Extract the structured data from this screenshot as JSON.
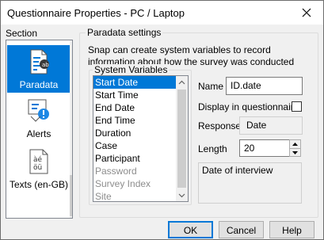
{
  "window": {
    "title": "Questionnaire Properties - PC / Laptop"
  },
  "sidebar": {
    "label": "Section",
    "items": [
      {
        "label": "Paradata",
        "icon": "paradata-icon",
        "selected": true
      },
      {
        "label": "Alerts",
        "icon": "alerts-icon",
        "selected": false
      },
      {
        "label": "Texts (en-GB)",
        "icon": "texts-icon",
        "selected": false
      }
    ]
  },
  "paradata": {
    "group_title": "Paradata settings",
    "description": "Snap can create system variables to record information about how the survey was conducted",
    "system_variables": {
      "title": "System Variables",
      "items": [
        {
          "label": "Start Date",
          "selected": true,
          "enabled": true
        },
        {
          "label": "Start Time",
          "selected": false,
          "enabled": true
        },
        {
          "label": "End Date",
          "selected": false,
          "enabled": true
        },
        {
          "label": "End Time",
          "selected": false,
          "enabled": true
        },
        {
          "label": "Duration",
          "selected": false,
          "enabled": true
        },
        {
          "label": "Case",
          "selected": false,
          "enabled": true
        },
        {
          "label": "Participant",
          "selected": false,
          "enabled": true
        },
        {
          "label": "Password",
          "selected": false,
          "enabled": false
        },
        {
          "label": "Survey Index",
          "selected": false,
          "enabled": false
        },
        {
          "label": "Site",
          "selected": false,
          "enabled": false
        }
      ]
    },
    "name": {
      "label": "Name",
      "value": "ID.date"
    },
    "display": {
      "label": "Display in questionnaire",
      "checked": false
    },
    "response": {
      "label": "Response",
      "value": "Date"
    },
    "length": {
      "label": "Length",
      "value": "20"
    },
    "memo": "Date of interview"
  },
  "buttons": {
    "ok": "OK",
    "cancel": "Cancel",
    "help": "Help"
  },
  "colors": {
    "selection": "#0078d7",
    "dialog_bg": "#f0f0f0"
  }
}
